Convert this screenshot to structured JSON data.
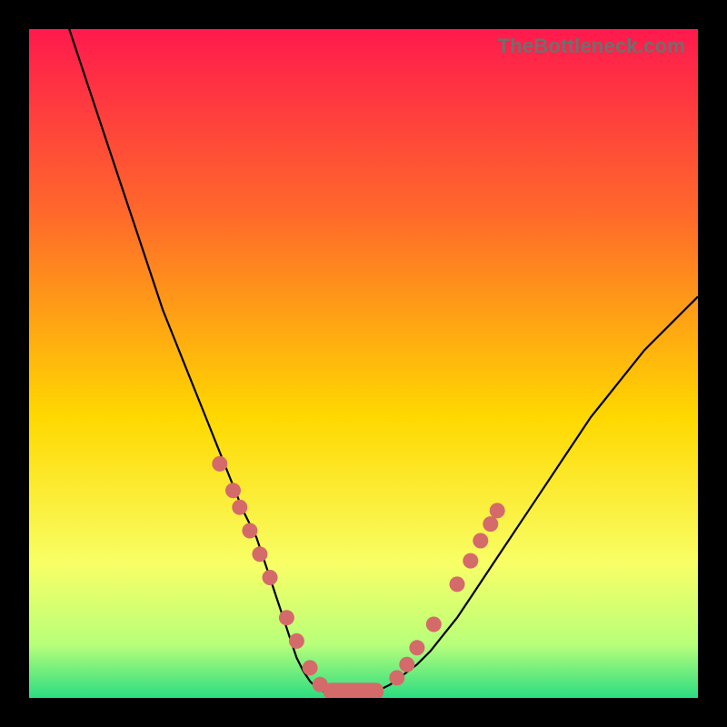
{
  "watermark": "TheBottleneck.com",
  "colors": {
    "frame": "#000000",
    "curve": "#000000",
    "dots": "#d56a6a",
    "grad_top": "#ff1a4d",
    "grad_upper": "#ff6a2a",
    "grad_mid": "#ffd800",
    "grad_low1": "#f8ff66",
    "grad_low2": "#b8ff7a",
    "grad_bottom": "#2bdc82"
  },
  "chart_data": {
    "type": "line",
    "title": "",
    "xlabel": "",
    "ylabel": "",
    "xlim": [
      0,
      100
    ],
    "ylim": [
      0,
      100
    ],
    "x": [
      6,
      8,
      10,
      12,
      14,
      16,
      18,
      20,
      22,
      24,
      26,
      28,
      30,
      32,
      34,
      35,
      36,
      37,
      38,
      39,
      40,
      41,
      42,
      43,
      44,
      45,
      46,
      48,
      50,
      52,
      54,
      56,
      58,
      60,
      62,
      64,
      66,
      68,
      70,
      72,
      74,
      76,
      78,
      80,
      82,
      84,
      86,
      88,
      90,
      92,
      94,
      96,
      98,
      100
    ],
    "y": [
      100,
      94,
      88,
      82,
      76,
      70,
      64,
      58,
      53,
      48,
      43,
      38,
      33,
      28,
      24,
      21,
      18,
      15,
      12,
      9,
      6,
      4,
      2.5,
      1.5,
      1,
      1,
      1,
      1,
      1,
      1,
      2,
      3.5,
      5,
      7,
      9.5,
      12,
      15,
      18,
      21,
      24,
      27,
      30,
      33,
      36,
      39,
      42,
      44.5,
      47,
      49.5,
      52,
      54,
      56,
      58,
      60
    ],
    "note": "V-shaped bottleneck curve; minimum (~0–1) around x≈43–51, left branch goes to 100 at x≈6, right branch rises to ~60 at x=100. Values are estimated from the image (no axis labels present).",
    "dots_left": [
      {
        "x": 28.5,
        "y": 35
      },
      {
        "x": 30.5,
        "y": 31
      },
      {
        "x": 31.5,
        "y": 28.5
      },
      {
        "x": 33.0,
        "y": 25
      },
      {
        "x": 34.5,
        "y": 21.5
      },
      {
        "x": 36.0,
        "y": 18
      },
      {
        "x": 38.5,
        "y": 12
      },
      {
        "x": 40.0,
        "y": 8.5
      },
      {
        "x": 42.0,
        "y": 4.5
      },
      {
        "x": 43.5,
        "y": 2
      }
    ],
    "dots_right": [
      {
        "x": 55.0,
        "y": 3
      },
      {
        "x": 56.5,
        "y": 5
      },
      {
        "x": 58.0,
        "y": 7.5
      },
      {
        "x": 60.5,
        "y": 11
      },
      {
        "x": 64.0,
        "y": 17
      },
      {
        "x": 66.0,
        "y": 20.5
      },
      {
        "x": 67.5,
        "y": 23.5
      },
      {
        "x": 69.0,
        "y": 26
      },
      {
        "x": 70.0,
        "y": 28
      }
    ],
    "floor_bar": {
      "x0": 44,
      "x1": 53,
      "y": 1,
      "thickness": 2.5
    }
  }
}
